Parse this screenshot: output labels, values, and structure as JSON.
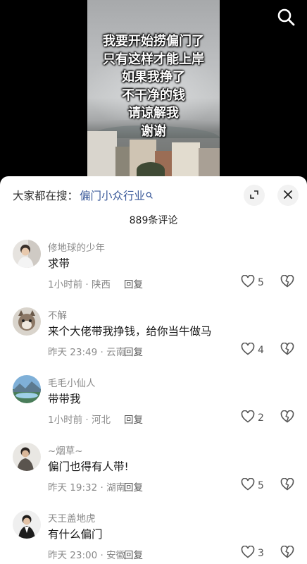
{
  "video": {
    "overlay_lines": [
      "我要开始捞偏门了",
      "只有这样才能上岸",
      "如果我挣了",
      "不干净的钱",
      "请谅解我",
      "谢谢"
    ]
  },
  "panel": {
    "search_prefix": "大家都在搜：",
    "search_term": "偏门小众行业",
    "comment_count": "889条评论"
  },
  "comments": [
    {
      "username": "修地球的少年",
      "text": "求带",
      "meta": "1小时前 · 陕西",
      "reply": "回复",
      "likes": "5"
    },
    {
      "username": "不解",
      "text": "来个大佬带我挣钱，给你当牛做马",
      "meta": "昨天 23:49 · 云南",
      "reply": "回复",
      "likes": "4"
    },
    {
      "username": "毛毛小仙人",
      "text": "带带我",
      "meta": "1小时前 · 河北",
      "reply": "回复",
      "likes": "2"
    },
    {
      "username": "~烟草~",
      "text": "偏门也得有人带!",
      "meta": "昨天 19:32 · 湖南",
      "reply": "回复",
      "likes": "5"
    },
    {
      "username": "天王盖地虎",
      "text": "有什么偏门",
      "meta": "昨天 23:00 · 安徽",
      "reply": "回复",
      "likes": "3"
    }
  ],
  "icons": {
    "top": "search-icon",
    "panel": [
      "search-small-icon",
      "expand-icon",
      "close-icon"
    ],
    "comment_actions": [
      "heart-icon",
      "dislike-heart-icon"
    ]
  },
  "colors": {
    "link": "#3b5a9a",
    "muted": "#8a8a8a",
    "panel_bg": "#ffffff"
  }
}
